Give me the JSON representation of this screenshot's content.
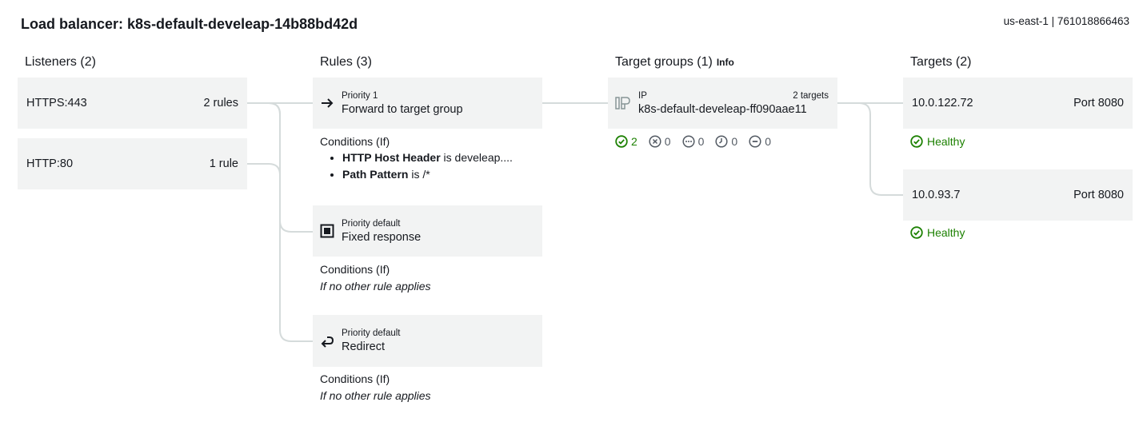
{
  "header": {
    "title": "Load balancer: k8s-default-develeap-14b88bd42d",
    "region": "us-east-1 | 761018866463"
  },
  "listeners": {
    "heading": "Listeners (2)",
    "items": [
      {
        "name": "HTTPS:443",
        "rules": "2 rules"
      },
      {
        "name": "HTTP:80",
        "rules": "1 rule"
      }
    ]
  },
  "rules": {
    "heading": "Rules (3)",
    "items": [
      {
        "priority": "Priority 1",
        "action": "Forward to target group",
        "icon": "arrow-right-icon",
        "conditions_title": "Conditions (If)",
        "conditions": [
          {
            "key": "HTTP Host Header",
            "text": " is develeap...."
          },
          {
            "key": "Path Pattern",
            "text": " is /*"
          }
        ]
      },
      {
        "priority": "Priority default",
        "action": "Fixed response",
        "icon": "fixed-response-icon",
        "conditions_title": "Conditions (If)",
        "conditions_text": "If no other rule applies"
      },
      {
        "priority": "Priority default",
        "action": "Redirect",
        "icon": "redirect-icon",
        "conditions_title": "Conditions (If)",
        "conditions_text": "If no other rule applies"
      }
    ]
  },
  "target_groups": {
    "heading": "Target groups (1)",
    "info": "Info",
    "items": [
      {
        "type": "IP",
        "count": "2 targets",
        "name": "k8s-default-develeap-ff090aae11",
        "status": {
          "healthy": "2",
          "unhealthy": "0",
          "unused": "0",
          "initial": "0",
          "draining": "0"
        }
      }
    ]
  },
  "targets": {
    "heading": "Targets (2)",
    "items": [
      {
        "ip": "10.0.122.72",
        "port": "Port 8080",
        "health": "Healthy"
      },
      {
        "ip": "10.0.93.7",
        "port": "Port 8080",
        "health": "Healthy"
      }
    ]
  },
  "colors": {
    "card_bg": "#f2f3f3",
    "connector": "#d5dbdb",
    "healthy": "#1d8102",
    "text": "#16191f",
    "muted_icon": "#545b64"
  }
}
